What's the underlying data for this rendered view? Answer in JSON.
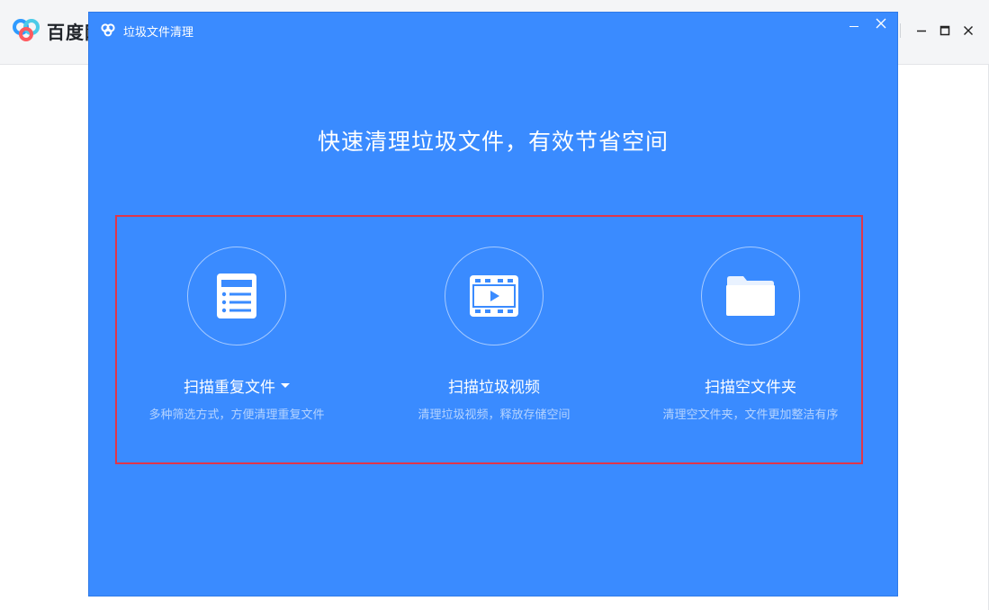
{
  "background_app": {
    "name": "百度网盘",
    "partial_text": "",
    "window_controls": {
      "minimize": "—",
      "maximize": "☐",
      "close": "✕"
    }
  },
  "dialog": {
    "title": "垃圾文件清理",
    "headline": "快速清理垃圾文件，有效节省空间",
    "options": [
      {
        "title": "扫描重复文件",
        "desc": "多种筛选方式，方便清理重复文件",
        "icon": "list-document-icon",
        "has_dropdown": true
      },
      {
        "title": "扫描垃圾视频",
        "desc": "清理垃圾视频，释放存储空间",
        "icon": "video-file-icon",
        "has_dropdown": false
      },
      {
        "title": "扫描空文件夹",
        "desc": "清理空文件夹，文件更加整洁有序",
        "icon": "folder-icon",
        "has_dropdown": false
      }
    ]
  },
  "colors": {
    "dialog_bg": "#3a8bff",
    "highlight_border": "#e0364a",
    "text": "#ffffff"
  }
}
